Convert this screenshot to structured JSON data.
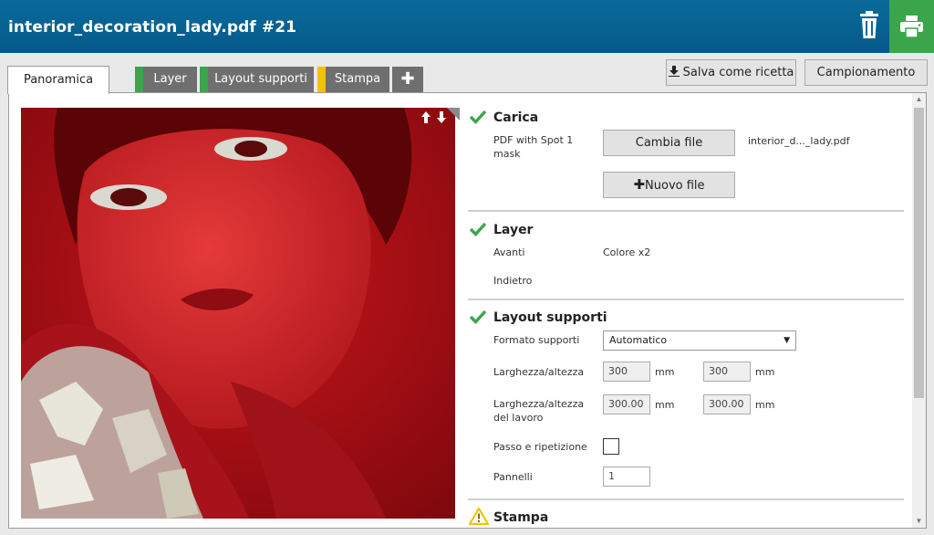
{
  "header": {
    "title": "interior_decoration_lady.pdf #21"
  },
  "tabs": [
    {
      "label": "Panoramica",
      "stripe": ""
    },
    {
      "label": "Layer",
      "stripe": "#3aa54b"
    },
    {
      "label": "Layout supporti",
      "stripe": "#3aa54b"
    },
    {
      "label": "Stampa",
      "stripe": "#f2c200"
    },
    {
      "label": "✚",
      "stripe": ""
    }
  ],
  "toolbar": {
    "save_recipe": "Salva come ricetta",
    "sampling": "Campionamento"
  },
  "sections": {
    "carica": {
      "title": "Carica",
      "file_type": "PDF with Spot 1 mask",
      "change_file": "Cambia file",
      "file_name": "interior_d..._lady.pdf",
      "new_file": "Nuovo file"
    },
    "layer": {
      "title": "Layer",
      "front_label": "Avanti",
      "front_value": "Colore x2",
      "back_label": "Indietro"
    },
    "layout": {
      "title": "Layout supporti",
      "format_label": "Formato supporti",
      "format_value": "Automatico",
      "size_label": "Larghezza/altezza",
      "width": "300",
      "height": "300",
      "unit": "mm",
      "job_size_label": "Larghezza/altezza del lavoro",
      "job_width": "300.00",
      "job_height": "300.00",
      "step_repeat_label": "Passo e ripetizione",
      "panels_label": "Pannelli",
      "panels_value": "1"
    },
    "stampa": {
      "title": "Stampa"
    }
  },
  "colors": {
    "header": "#045a89",
    "print_button": "#3aa54b",
    "check": "#3aa54b",
    "warning": "#f2c200"
  }
}
